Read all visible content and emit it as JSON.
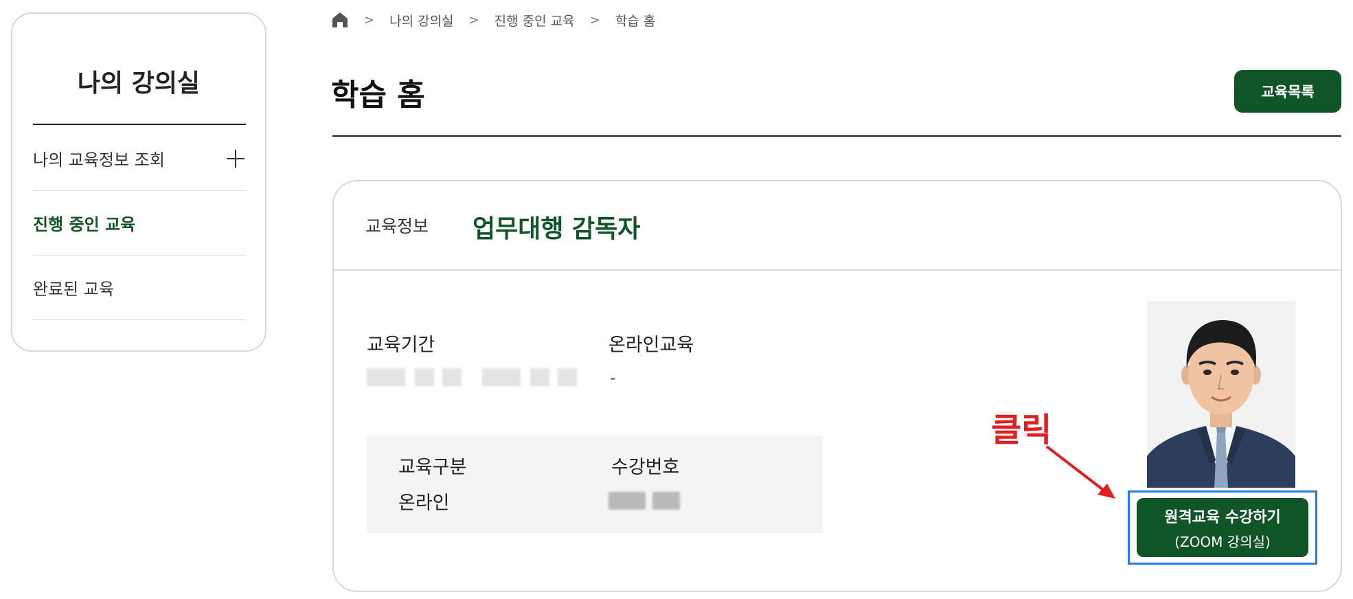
{
  "sidebar": {
    "title": "나의 강의실",
    "items": [
      {
        "label": "나의 교육정보 조회",
        "expandable": true,
        "active": false
      },
      {
        "label": "진행 중인 교육",
        "expandable": false,
        "active": true
      },
      {
        "label": "완료된 교육",
        "expandable": false,
        "active": false
      }
    ]
  },
  "breadcrumb": {
    "home_icon": "home-icon",
    "separator": ">",
    "items": [
      "나의 강의실",
      "진행 중인 교육",
      "학습 홈"
    ]
  },
  "header": {
    "title": "학습 홈",
    "list_button_label": "교육목록"
  },
  "card": {
    "info_label": "교육정보",
    "course_title": "업무대행 감독자",
    "period_label": "교육기간",
    "online_label": "온라인교육",
    "online_value": "-",
    "category_label": "교육구분",
    "category_value": "온라인",
    "enroll_no_label": "수강번호",
    "zoom_button_line1": "원격교육 수강하기",
    "zoom_button_line2": "(ZOOM 강의실)"
  },
  "annotation": {
    "click_label": "클릭",
    "color": "#e02020",
    "frame_color": "#1f7fe0"
  },
  "colors": {
    "brand_green": "#0f5528",
    "border": "#d8d8d8"
  }
}
